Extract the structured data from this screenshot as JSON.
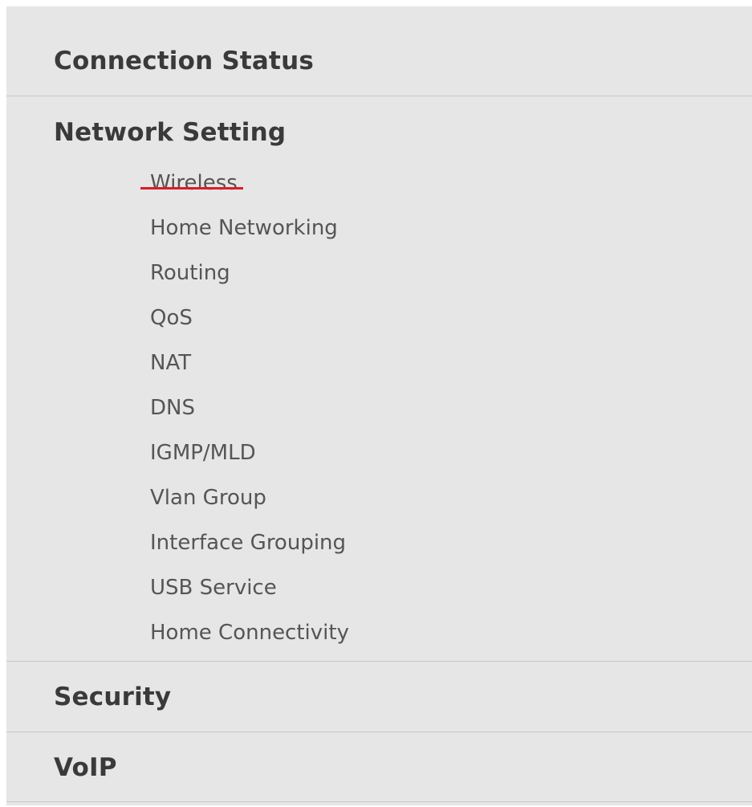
{
  "menu": {
    "sections": {
      "connection_status": {
        "label": "Connection Status"
      },
      "network_setting": {
        "label": "Network Setting",
        "items": [
          {
            "label": "Wireless"
          },
          {
            "label": "Home Networking"
          },
          {
            "label": "Routing"
          },
          {
            "label": "QoS"
          },
          {
            "label": "NAT"
          },
          {
            "label": "DNS"
          },
          {
            "label": "IGMP/MLD"
          },
          {
            "label": "Vlan Group"
          },
          {
            "label": "Interface Grouping"
          },
          {
            "label": "USB Service"
          },
          {
            "label": "Home Connectivity"
          }
        ],
        "active_item": "Wireless"
      },
      "security": {
        "label": "Security"
      },
      "voip": {
        "label": "VoIP"
      }
    },
    "colors": {
      "panel_background": "#e6e6e6",
      "header_text": "#3a3a3a",
      "item_text": "#555555",
      "divider": "#c8c8c8",
      "active_indicator": "#d91f26"
    }
  }
}
